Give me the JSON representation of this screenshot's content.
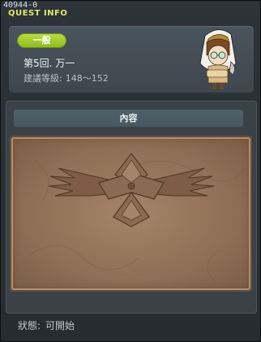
{
  "quest_id": "40944-0",
  "title": "QUEST INFO",
  "header": {
    "category_badge": "一般",
    "quest_name": "第5回. 万一",
    "level_label": "建議等級:",
    "level_range": "148～152"
  },
  "npc": {
    "icon": "npc-portrait-icon"
  },
  "content": {
    "tab_label": "內容"
  },
  "status": {
    "label": "狀態:",
    "value": "可開始"
  },
  "colors": {
    "badge_green": "#9ccb2b",
    "title_yellow": "#e6e86a",
    "parchment": "#95755a"
  }
}
